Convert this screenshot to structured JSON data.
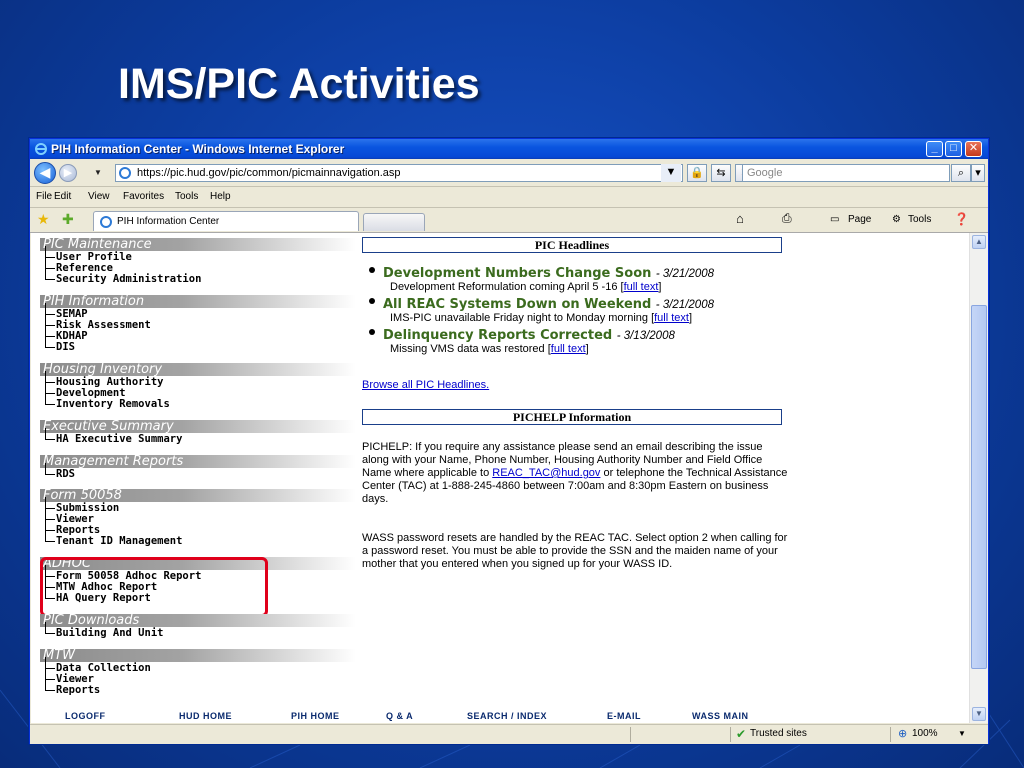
{
  "slide": {
    "title": "IMS/PIC Activities"
  },
  "browser": {
    "window_title": "PIH Information Center - Windows Internet Explorer",
    "url": "https://pic.hud.gov/pic/common/picmainnavigation.asp",
    "search_placeholder": "Google",
    "menu": [
      "File",
      "Edit",
      "View",
      "Favorites",
      "Tools",
      "Help"
    ],
    "tab_label": "PIH Information Center",
    "commands": {
      "page": "Page",
      "tools": "Tools"
    },
    "status": {
      "trusted": "Trusted sites",
      "zoom": "100%"
    }
  },
  "leftnav": {
    "sections": [
      {
        "title": "PIC Maintenance",
        "items": [
          "User Profile",
          "Reference",
          "Security Administration"
        ]
      },
      {
        "title": "PIH Information",
        "items": [
          "SEMAP",
          "Risk Assessment",
          "KDHAP",
          "DIS"
        ]
      },
      {
        "title": "Housing Inventory",
        "items": [
          "Housing Authority",
          "Development",
          "Inventory Removals"
        ]
      },
      {
        "title": "Executive Summary",
        "items": [
          "HA Executive Summary"
        ]
      },
      {
        "title": "Management Reports",
        "items": [
          "RDS"
        ]
      },
      {
        "title": "Form 50058",
        "items": [
          "Submission",
          "Viewer",
          "Reports",
          "Tenant ID Management"
        ]
      },
      {
        "title": "ADHOC",
        "items": [
          "Form 50058 Adhoc Report",
          "MTW Adhoc Report",
          "HA Query Report"
        ]
      },
      {
        "title": "PIC Downloads",
        "items": [
          "Building And Unit"
        ]
      },
      {
        "title": "MTW",
        "items": [
          "Data Collection",
          "Viewer",
          "Reports"
        ]
      }
    ]
  },
  "headlines": {
    "panel_title": "PIC Headlines",
    "items": [
      {
        "title": "Development Numbers Change Soon",
        "date": "- 3/21/2008",
        "desc": "Development Reformulation coming April 5 -16 [",
        "link": "full text",
        "end": "]"
      },
      {
        "title": "All REAC Systems Down on Weekend",
        "date": "- 3/21/2008",
        "desc": "IMS-PIC unavailable Friday night to Monday morning [",
        "link": "full text",
        "end": "]"
      },
      {
        "title": "Delinquency Reports Corrected",
        "date": "- 3/13/2008",
        "desc": "Missing VMS data was restored [",
        "link": "full text",
        "end": "]"
      }
    ],
    "browse_link": "Browse all PIC Headlines."
  },
  "pichelp": {
    "panel_title": "PICHELP Information",
    "para1_a": "PICHELP: If you require any assistance please send an email describing the issue along with your Name, Phone Number, Housing Authority Number and Field Office Name where applicable to",
    "email": "REAC_TAC@hud.gov",
    "para1_b": " or telephone the Technical Assistance Center (TAC) at 1-888-245-4860 between 7:00am and 8:30pm Eastern on business days.",
    "para2": "WASS password resets are handled by the REAC TAC. Select option 2 when calling for a password reset. You must be able to provide the SSN and the maiden name of your mother that you entered when you signed up for your WASS ID."
  },
  "footer_links": [
    "LOGOFF",
    "HUD HOME",
    "PIH HOME",
    "Q & A",
    "SEARCH / INDEX",
    "E-MAIL",
    "WASS MAIN"
  ]
}
